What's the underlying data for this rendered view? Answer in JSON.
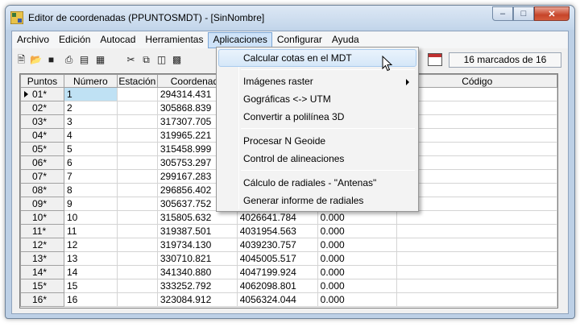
{
  "window": {
    "title": "Editor de coordenadas (PPUNTOSMDT) - [SinNombre]"
  },
  "menubar": [
    "Archivo",
    "Edición",
    "Autocad",
    "Herramientas",
    "Aplicaciones",
    "Configurar",
    "Ayuda"
  ],
  "toolbar": {
    "icons": [
      "new-file-icon",
      "open-folder-icon",
      "save-icon",
      "print-icon",
      "export-icon",
      "import-icon",
      "cut-icon",
      "copy-icon",
      "paste-icon",
      "paste-special-icon"
    ],
    "status": "16 marcados de 16"
  },
  "grid": {
    "columns": [
      "Puntos",
      "Número",
      "Estación",
      "Coordenada",
      "",
      "",
      "Código"
    ],
    "rows": [
      {
        "label": "01*",
        "num": "1",
        "est": "",
        "x": "294314.431",
        "y": "",
        "z": ""
      },
      {
        "label": "02*",
        "num": "2",
        "est": "",
        "x": "305868.839",
        "y": "",
        "z": ""
      },
      {
        "label": "03*",
        "num": "3",
        "est": "",
        "x": "317307.705",
        "y": "",
        "z": ""
      },
      {
        "label": "04*",
        "num": "4",
        "est": "",
        "x": "319965.221",
        "y": "",
        "z": ""
      },
      {
        "label": "05*",
        "num": "5",
        "est": "",
        "x": "315458.999",
        "y": "",
        "z": ""
      },
      {
        "label": "06*",
        "num": "6",
        "est": "",
        "x": "305753.297",
        "y": "",
        "z": ""
      },
      {
        "label": "07*",
        "num": "7",
        "est": "",
        "x": "299167.283",
        "y": "",
        "z": ""
      },
      {
        "label": "08*",
        "num": "8",
        "est": "",
        "x": "296856.402",
        "y": "",
        "z": ""
      },
      {
        "label": "09*",
        "num": "9",
        "est": "",
        "x": "305637.752",
        "y": "",
        "z": ""
      },
      {
        "label": "10*",
        "num": "10",
        "est": "",
        "x": "315805.632",
        "y": "4026641.784",
        "z": "0.000"
      },
      {
        "label": "11*",
        "num": "11",
        "est": "",
        "x": "319387.501",
        "y": "4031954.563",
        "z": "0.000"
      },
      {
        "label": "12*",
        "num": "12",
        "est": "",
        "x": "319734.130",
        "y": "4039230.757",
        "z": "0.000"
      },
      {
        "label": "13*",
        "num": "13",
        "est": "",
        "x": "330710.821",
        "y": "4045005.517",
        "z": "0.000"
      },
      {
        "label": "14*",
        "num": "14",
        "est": "",
        "x": "341340.880",
        "y": "4047199.924",
        "z": "0.000"
      },
      {
        "label": "15*",
        "num": "15",
        "est": "",
        "x": "333252.792",
        "y": "4062098.801",
        "z": "0.000"
      },
      {
        "label": "16*",
        "num": "16",
        "est": "",
        "x": "323084.912",
        "y": "4056324.044",
        "z": "0.000"
      }
    ]
  },
  "dropdown": {
    "items": [
      {
        "label": "Calcular cotas en el MDT",
        "hover": true
      },
      {
        "label": "Imágenes raster",
        "submenu": true
      },
      {
        "label": "Gográficas <-> UTM"
      },
      {
        "label": "Convertir a polilínea 3D"
      },
      {
        "label": "Procesar N Geoide"
      },
      {
        "label": "Control de alineaciones"
      },
      {
        "label": "Cálculo de radiales - \"Antenas\""
      },
      {
        "label": "Generar informe de radiales"
      }
    ]
  }
}
